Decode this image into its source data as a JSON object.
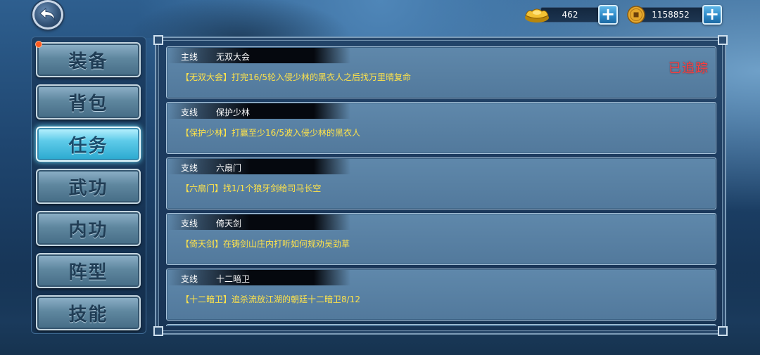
{
  "currency": {
    "ingot": {
      "icon": "gold-ingot-icon",
      "value": "462"
    },
    "coin": {
      "icon": "copper-coin-icon",
      "value": "1158852"
    }
  },
  "nav": {
    "items": [
      {
        "label": "装备",
        "active": false,
        "badge": true
      },
      {
        "label": "背包",
        "active": false,
        "badge": false
      },
      {
        "label": "任务",
        "active": true,
        "badge": false
      },
      {
        "label": "武功",
        "active": false,
        "badge": false
      },
      {
        "label": "内功",
        "active": false,
        "badge": false
      },
      {
        "label": "阵型",
        "active": false,
        "badge": false
      },
      {
        "label": "技能",
        "active": false,
        "badge": false
      }
    ]
  },
  "quests": [
    {
      "type": "主线",
      "name": "无双大会",
      "desc": "【无双大会】打完16/5轮入侵少林的黑衣人之后找万里晴复命",
      "status": "已追踪"
    },
    {
      "type": "支线",
      "name": "保护少林",
      "desc": "【保护少林】打赢至少16/5波入侵少林的黑衣人",
      "status": ""
    },
    {
      "type": "支线",
      "name": "六扇门",
      "desc": "【六扇门】找1/1个狼牙剑给司马长空",
      "status": ""
    },
    {
      "type": "支线",
      "name": "倚天剑",
      "desc": "【倚天剑】在铸剑山庄内打听如何规劝吴劲草",
      "status": ""
    },
    {
      "type": "支线",
      "name": "十二暗卫",
      "desc": "【十二暗卫】追杀流放江湖的朝廷十二暗卫8/12",
      "status": ""
    }
  ],
  "colors": {
    "tracked": "#ff3e3e",
    "desc": "#ffe34a",
    "active_tab": "#5ecbe9"
  }
}
